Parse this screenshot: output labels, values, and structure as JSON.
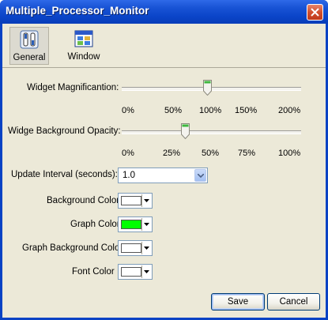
{
  "window": {
    "title": "Multiple_Processor_Monitor"
  },
  "toolbar": {
    "items": [
      {
        "label": "General",
        "selected": true
      },
      {
        "label": "Window",
        "selected": false
      }
    ]
  },
  "magnification": {
    "label": "Widget Magnificantion:",
    "value_percent": 100,
    "ticks": [
      "0%",
      "50%",
      "100%",
      "150%",
      "200%"
    ]
  },
  "opacity": {
    "label": "Widge Background Opacity:",
    "value_percent": 37,
    "ticks": [
      "0%",
      "25%",
      "50%",
      "75%",
      "100%"
    ]
  },
  "update_interval": {
    "label": "Update Interval (seconds):",
    "value": "1.0"
  },
  "colors": [
    {
      "label": "Background Color",
      "color": "#ffffff"
    },
    {
      "label": "Graph Color",
      "color": "#00ff00"
    },
    {
      "label": "Graph Background Color",
      "color": "#ffffff"
    },
    {
      "label": "Font Color",
      "color": "#ffffff"
    }
  ],
  "buttons": {
    "save": "Save",
    "cancel": "Cancel"
  }
}
